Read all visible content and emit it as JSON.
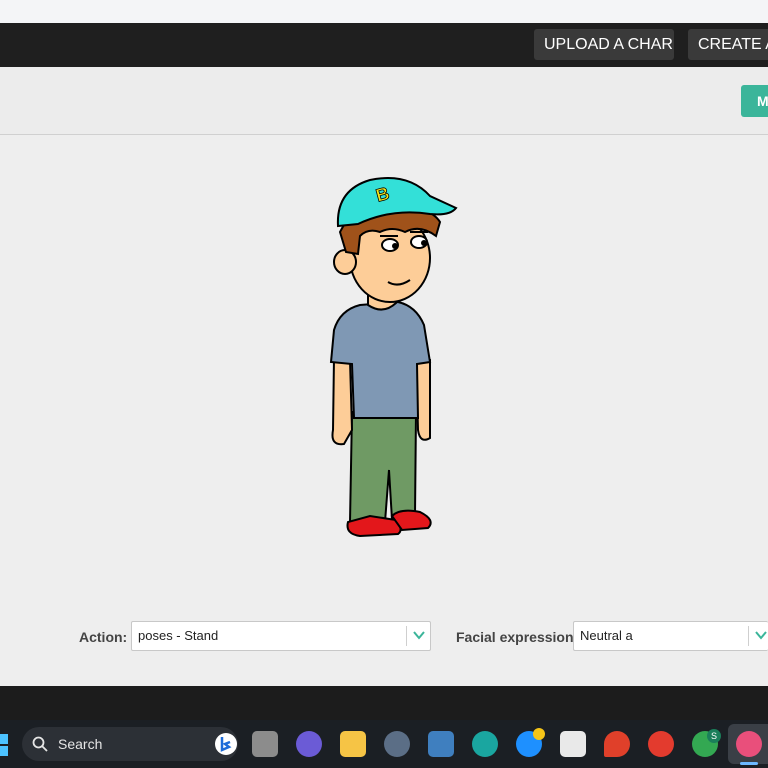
{
  "nav": {
    "upload_label": "UPLOAD A CHAR",
    "create_label": "CREATE A"
  },
  "toolbar": {
    "teal_label": "M"
  },
  "controls": {
    "action_label": "Action:",
    "action_value": "poses - Stand",
    "facial_label": "Facial expression:",
    "facial_value": "Neutral a"
  },
  "character": {
    "cap_letter": "B",
    "cap_color": "#33e0d8",
    "shirt_color": "#7f98b4",
    "pants_color": "#6f9a64",
    "shoe_color": "#e3171b",
    "skin_color": "#fdcd98",
    "hair_color": "#a0521a"
  },
  "taskbar": {
    "search_label": "Search",
    "chrome_badge": "S"
  }
}
